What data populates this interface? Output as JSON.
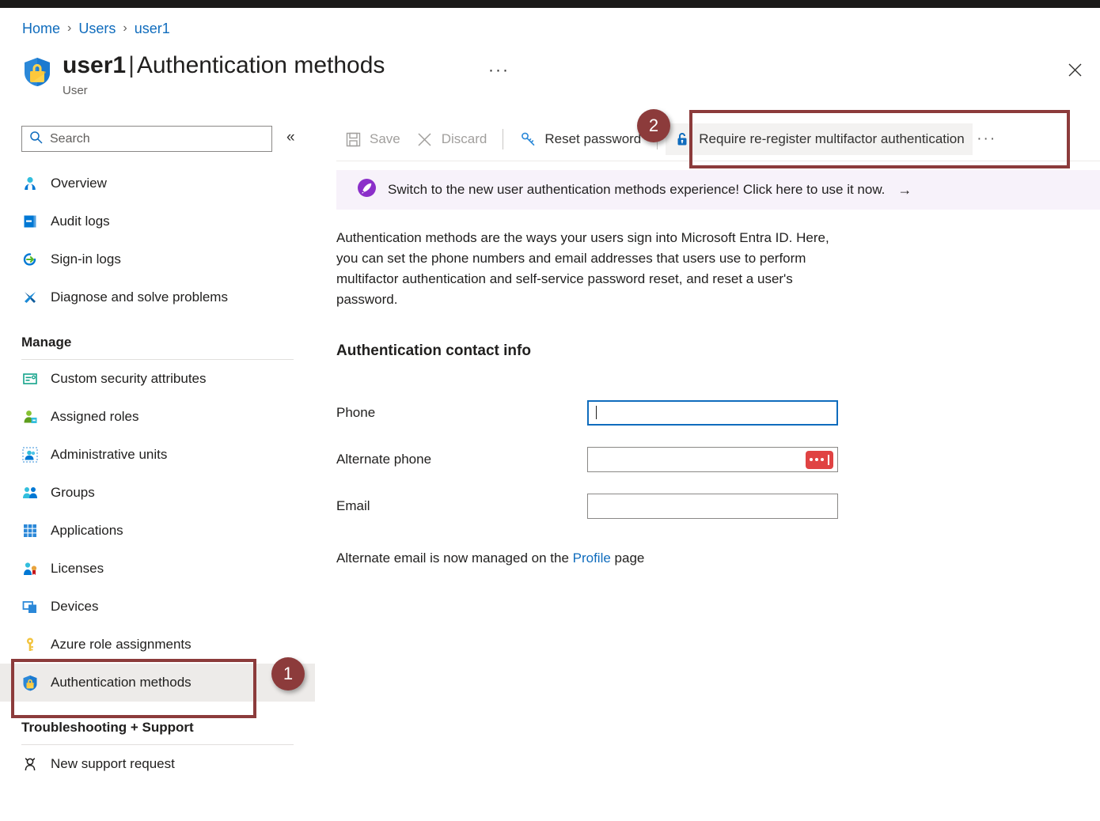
{
  "breadcrumb": {
    "items": [
      {
        "label": "Home"
      },
      {
        "label": "Users"
      },
      {
        "label": "user1"
      }
    ],
    "separator": "›"
  },
  "header": {
    "icon": "shield-lock-icon",
    "name": "user1",
    "pipe": "|",
    "page": "Authentication methods",
    "subtitle": "User",
    "ellipsis": "···",
    "close_icon": "close-icon"
  },
  "search": {
    "placeholder": "Search",
    "icon": "search-icon",
    "collapse_icon": "«"
  },
  "sidebar": {
    "items": [
      {
        "label": "Overview",
        "icon": "user-icon",
        "selected": false
      },
      {
        "label": "Audit logs",
        "icon": "audit-log-icon",
        "selected": false
      },
      {
        "label": "Sign-in logs",
        "icon": "sign-in-icon",
        "selected": false
      },
      {
        "label": "Diagnose and solve problems",
        "icon": "wrench-icon",
        "selected": false
      }
    ],
    "manage": {
      "title": "Manage",
      "items": [
        {
          "label": "Custom security attributes",
          "icon": "attributes-icon",
          "selected": false
        },
        {
          "label": "Assigned roles",
          "icon": "assigned-roles-icon",
          "selected": false
        },
        {
          "label": "Administrative units",
          "icon": "administrative-units-icon",
          "selected": false
        },
        {
          "label": "Groups",
          "icon": "groups-icon",
          "selected": false
        },
        {
          "label": "Applications",
          "icon": "applications-icon",
          "selected": false
        },
        {
          "label": "Licenses",
          "icon": "licenses-icon",
          "selected": false
        },
        {
          "label": "Devices",
          "icon": "devices-icon",
          "selected": false
        },
        {
          "label": "Azure role assignments",
          "icon": "key-icon",
          "selected": false
        },
        {
          "label": "Authentication methods",
          "icon": "shield-lock-icon",
          "selected": true
        }
      ]
    },
    "troubleshooting": {
      "title": "Troubleshooting + Support",
      "items": [
        {
          "label": "New support request",
          "icon": "support-person-icon",
          "selected": false
        }
      ]
    }
  },
  "toolbar": {
    "save_label": "Save",
    "discard_label": "Discard",
    "reset_password_label": "Reset password",
    "require_reregister_label": "Require re-register multifactor authentication",
    "overflow_label": "···"
  },
  "banner": {
    "icon": "rocket-icon",
    "text": "Switch to the new user authentication methods experience! Click here to use it now.",
    "arrow": "→"
  },
  "main": {
    "intro": "Authentication methods are the ways your users sign into Microsoft Entra ID. Here, you can set the phone numbers and email addresses that users use to perform multifactor authentication and self-service password reset, and reset a user's password.",
    "section_title": "Authentication contact info",
    "fields": [
      {
        "label": "Phone",
        "value": "",
        "placeholder": "",
        "focused": true,
        "badge": false
      },
      {
        "label": "Alternate phone",
        "value": "",
        "placeholder": "",
        "focused": false,
        "badge": true
      },
      {
        "label": "Email",
        "value": "",
        "placeholder": "",
        "focused": false,
        "badge": false
      }
    ],
    "footnote_before": "Alternate email is now managed on the ",
    "footnote_link": "Profile",
    "footnote_after": " page"
  },
  "annotations": [
    {
      "number": "1",
      "target": "sidebar-item-authentication-methods"
    },
    {
      "number": "2",
      "target": "require-reregister-mfa-button"
    }
  ],
  "colors": {
    "accent": "#0f6cbd",
    "annotation": "#8c3b3b",
    "banner_bg": "#f7f2fa",
    "selected_bg": "#edebe9",
    "red_badge": "#e04343"
  }
}
